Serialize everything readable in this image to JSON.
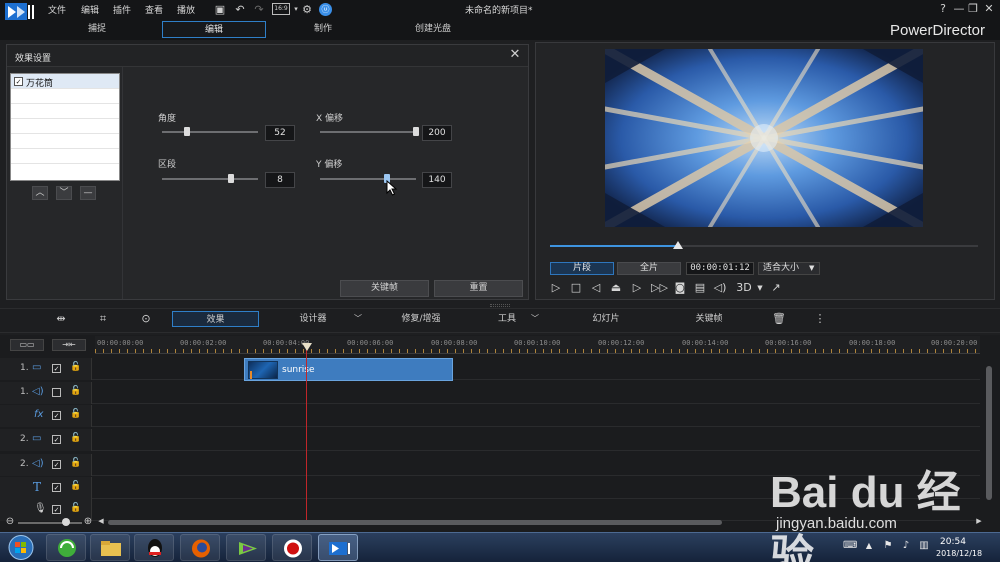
{
  "menu": [
    "文件",
    "编辑",
    "插件",
    "查看",
    "播放"
  ],
  "toolbar_top": {
    "aspect_ratio": "16:9"
  },
  "doc_title": "未命名的新项目*",
  "window": {
    "help": "?",
    "minimize": "—",
    "restore": "❐",
    "close": "✕"
  },
  "tabs": [
    "捕捉",
    "编辑",
    "制作",
    "创建光盘"
  ],
  "active_tab": "编辑",
  "brand": "PowerDirector",
  "effects_panel": {
    "title": "效果设置",
    "effect_name": "万花筒",
    "effect_checked": true,
    "params": {
      "angle": {
        "label": "角度",
        "value": "52",
        "level": 0.2
      },
      "x_offset": {
        "label": "X 偏移",
        "value": "200",
        "level": 0.97
      },
      "segment": {
        "label": "区段",
        "value": "8",
        "level": 0.73
      },
      "y_offset": {
        "label": "Y 偏移",
        "value": "140",
        "level": 0.7
      }
    },
    "keyframe_button": "关键帧",
    "reset_button": "重置"
  },
  "preview": {
    "progress": 0.3,
    "clip_mode": "片段",
    "full_mode": "全片",
    "timecode": "00:00:01:12",
    "fit": "适合大小",
    "three_d": "3D"
  },
  "toolbar": {
    "effect": "效果",
    "designer": "设计器",
    "fix": "修复/增强",
    "tools": "工具",
    "slideshow": "幻灯片",
    "keyframe": "关键帧"
  },
  "ruler": [
    "00:00:00:00",
    "00:00:02:00",
    "00:00:04:00",
    "00:00:06:00",
    "00:00:08:00",
    "00:00:10:00",
    "00:00:12:00",
    "00:00:14:00",
    "00:00:16:00",
    "00:00:18:00",
    "00:00:20:00"
  ],
  "tracks": [
    {
      "num": "1.",
      "type": "video",
      "checked": true
    },
    {
      "num": "1.",
      "type": "audio",
      "checked": false
    },
    {
      "num": "",
      "type": "fx",
      "checked": true
    },
    {
      "num": "2.",
      "type": "video",
      "checked": true
    },
    {
      "num": "2.",
      "type": "audio",
      "checked": true
    },
    {
      "num": "",
      "type": "title",
      "checked": true
    },
    {
      "num": "",
      "type": "voice",
      "checked": true
    }
  ],
  "clip": {
    "name": "sunrise"
  },
  "clock": {
    "time": "20:54",
    "date": "2018/12/18"
  },
  "watermark": {
    "logo": "Bai du 经验",
    "url": "jingyan.baidu.com"
  },
  "colors": {
    "accent": "#2f7fc8",
    "clip": "#3e7cbf",
    "playhead": "#c0262a"
  }
}
